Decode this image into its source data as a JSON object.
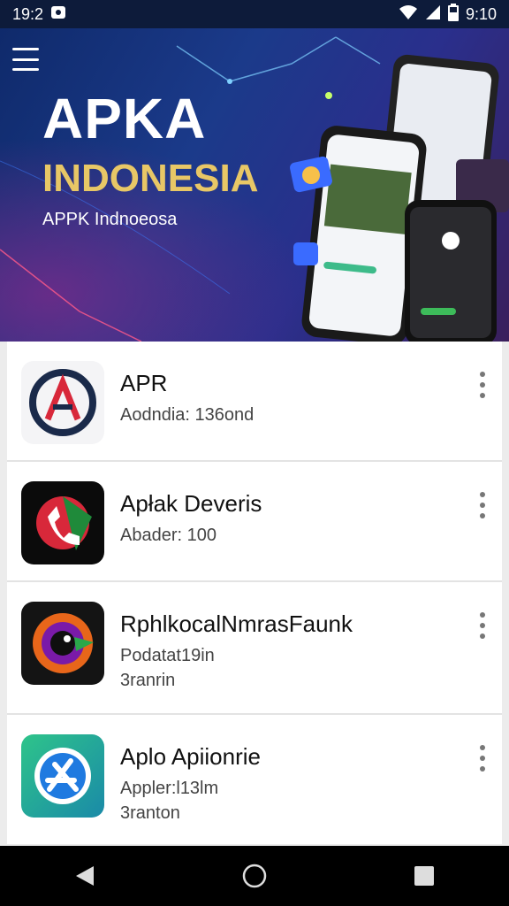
{
  "status_bar": {
    "time_left": "19:2",
    "time_right": "9:10"
  },
  "hero": {
    "title": "APKA",
    "subtitle": "INDONESIA",
    "tagline": "APPK Indnoeosa"
  },
  "apps": [
    {
      "name": "APR",
      "meta": "Aodndia: 136ond",
      "meta2": ""
    },
    {
      "name": "Apłak Deveris",
      "meta": "Abader: 100",
      "meta2": ""
    },
    {
      "name": "RphlkocalNmrasFaunk",
      "meta": "Podatat19in",
      "meta2": "3ranrin"
    },
    {
      "name": "Aplo Apiionrie",
      "meta": "Appler:l13lm",
      "meta2": "3ranton"
    }
  ],
  "colors": {
    "hero_gold": "#e8c766",
    "status_bg": "#0d1b3a",
    "nav_bg": "#000000"
  }
}
